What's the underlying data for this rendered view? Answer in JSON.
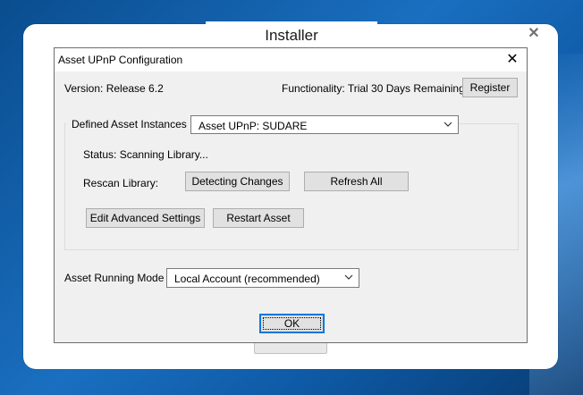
{
  "outer_window": {
    "title": "Installer",
    "close_glyph": "✕"
  },
  "dialog": {
    "title": "Asset UPnP Configuration",
    "close_glyph": "✕",
    "version_text": "Version: Release 6.2",
    "functionality_text": "Functionality: Trial 30 Days Remaining",
    "register_label": "Register",
    "instances": {
      "label": "Defined Asset Instances",
      "selected": "Asset UPnP: SUDARE",
      "status_text": "Status: Scanning Library...",
      "rescan_label": "Rescan Library:",
      "detecting_label": "Detecting Changes",
      "refresh_label": "Refresh All",
      "edit_advanced_label": "Edit Advanced Settings",
      "restart_label": "Restart Asset"
    },
    "running_mode": {
      "label": "Asset Running Mode",
      "selected": "Local Account (recommended)"
    },
    "ok_label": "OK"
  },
  "icons": {
    "outer_close": "close-icon",
    "dialog_close": "close-icon",
    "dropdown": "chevron-down-icon"
  }
}
